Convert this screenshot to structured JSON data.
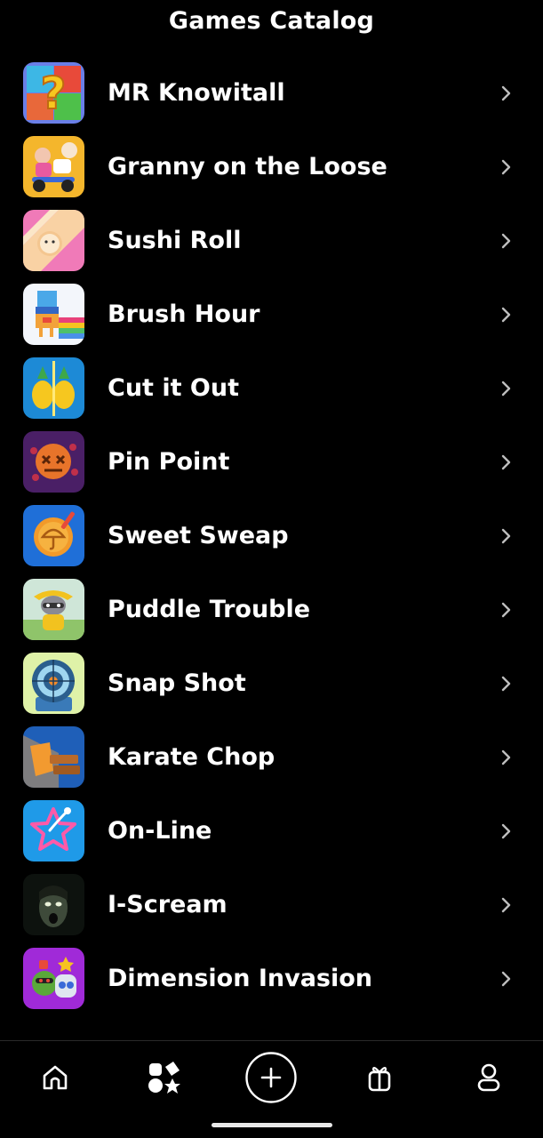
{
  "header": {
    "title": "Games Catalog"
  },
  "games": [
    {
      "name": "MR Knowitall",
      "icon": "question-block-icon"
    },
    {
      "name": "Granny on the Loose",
      "icon": "granny-scooter-icon"
    },
    {
      "name": "Sushi Roll",
      "icon": "sushi-ball-icon"
    },
    {
      "name": "Brush Hour",
      "icon": "blocky-bird-icon"
    },
    {
      "name": "Cut it Out",
      "icon": "split-pineapple-icon"
    },
    {
      "name": "Pin Point",
      "icon": "voodoo-doll-icon"
    },
    {
      "name": "Sweet Sweap",
      "icon": "cookie-umbrella-icon"
    },
    {
      "name": "Puddle Trouble",
      "icon": "raccoon-raincoat-icon"
    },
    {
      "name": "Snap Shot",
      "icon": "target-scope-icon"
    },
    {
      "name": "Karate Chop",
      "icon": "karate-hand-brick-icon"
    },
    {
      "name": "On-Line",
      "icon": "neon-star-icon"
    },
    {
      "name": "I-Scream",
      "icon": "horror-face-icon"
    },
    {
      "name": "Dimension Invasion",
      "icon": "goblin-robot-icon"
    }
  ],
  "nav": {
    "items": [
      "home-icon",
      "games-shapes-icon",
      "add-circle-icon",
      "gift-icon",
      "profile-icon"
    ],
    "active": "games-shapes-icon"
  }
}
